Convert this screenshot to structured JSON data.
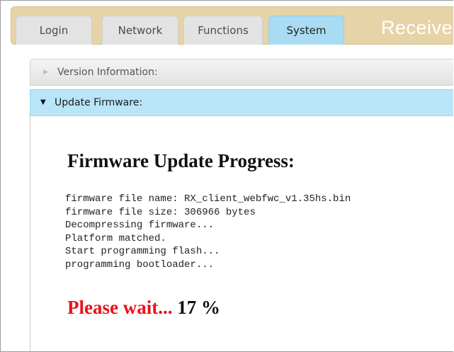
{
  "tabs": [
    {
      "label": "Login",
      "active": false
    },
    {
      "label": "Network",
      "active": false
    },
    {
      "label": "Functions",
      "active": false
    },
    {
      "label": "System",
      "active": true
    }
  ],
  "header": {
    "title": "Receiver"
  },
  "accordion": {
    "version_label": "Version Information:",
    "update_label": "Update Firmware:"
  },
  "update": {
    "title": "Firmware Update Progress:",
    "log": [
      "firmware file name: RX_client_webfwc_v1.35hs.bin",
      "firmware file size: 306966 bytes",
      "Decompressing firmware...",
      "Platform matched.",
      "Start programming flash...",
      "programming bootloader..."
    ],
    "wait_label": "Please wait...",
    "percent_text": "17 %",
    "progress_percent": 17
  },
  "colors": {
    "tabbar_bg": "#e6d3a8",
    "active_tab": "#a9dcf3",
    "wait_red": "#e8131b"
  },
  "icons": {
    "collapsed": "triangle-right-icon",
    "expanded": "triangle-down-icon"
  }
}
